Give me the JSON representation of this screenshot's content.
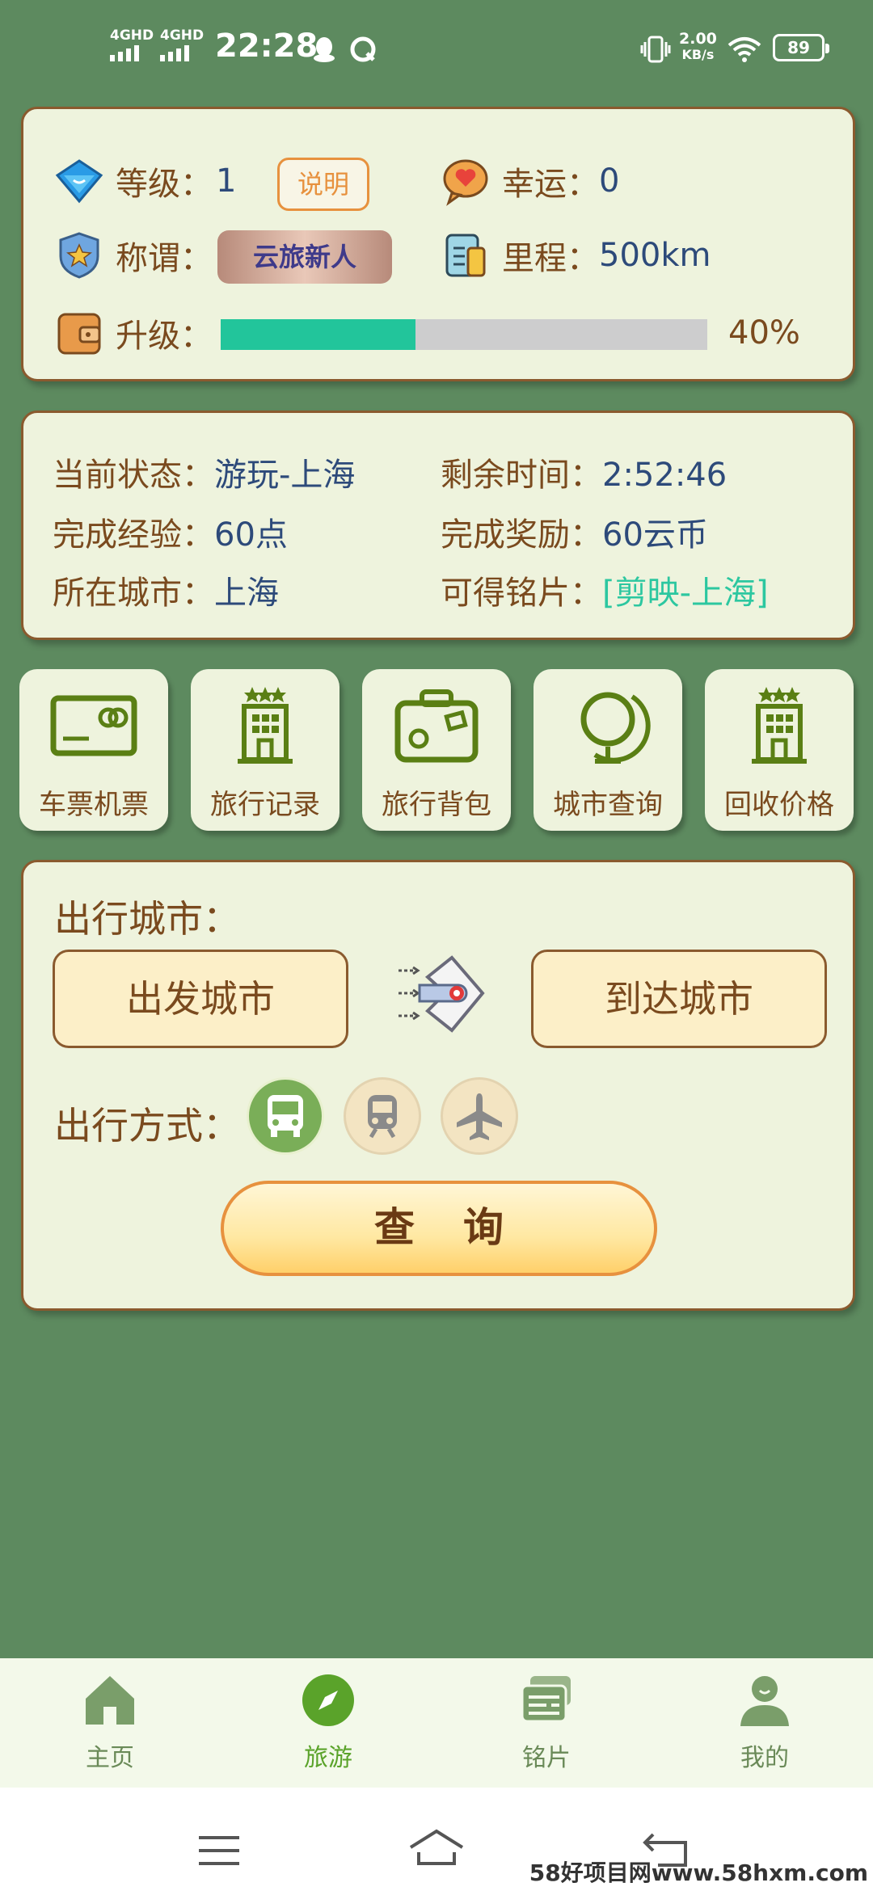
{
  "status_bar": {
    "signal1": "4GHD",
    "signal2": "4GHD",
    "time": "22:28",
    "speed_value": "2.00",
    "speed_unit": "KB/s",
    "battery": "89"
  },
  "profile": {
    "level_label": "等级：",
    "level_value": "1",
    "explain_button": "说明",
    "luck_label": "幸运：",
    "luck_value": "0",
    "title_label": "称谓：",
    "title_badge": "云旅新人",
    "mileage_label": "里程：",
    "mileage_value": "500km",
    "upgrade_label": "升级：",
    "upgrade_progress_percent": 40,
    "upgrade_percent_text": "40%"
  },
  "status_info": {
    "current_status_label": "当前状态：",
    "current_status_value": "游玩-上海",
    "remaining_time_label": "剩余时间：",
    "remaining_time_value": "2:52:46",
    "exp_label": "完成经验：",
    "exp_value": "60点",
    "reward_label": "完成奖励：",
    "reward_value": "60云币",
    "city_label": "所在城市：",
    "city_value": "上海",
    "postcard_label": "可得铭片：",
    "postcard_value": "[剪映-上海]"
  },
  "menu": [
    {
      "label": "车票机票",
      "icon": "ticket-icon"
    },
    {
      "label": "旅行记录",
      "icon": "hotel-icon"
    },
    {
      "label": "旅行背包",
      "icon": "suitcase-icon"
    },
    {
      "label": "城市查询",
      "icon": "globe-icon"
    },
    {
      "label": "回收价格",
      "icon": "hotel-icon"
    }
  ],
  "travel": {
    "city_heading": "出行城市：",
    "departure_button": "出发城市",
    "arrival_button": "到达城市",
    "mode_heading": "出行方式：",
    "modes": [
      "bus-icon",
      "train-icon",
      "airplane-icon"
    ],
    "query_button": "查询"
  },
  "bottom_nav": [
    {
      "label": "主页",
      "icon": "home-icon"
    },
    {
      "label": "旅游",
      "icon": "compass-icon"
    },
    {
      "label": "铭片",
      "icon": "cards-icon"
    },
    {
      "label": "我的",
      "icon": "user-icon"
    }
  ],
  "colors": {
    "background": "#5d8a5f",
    "card": "#eef3dd",
    "accent_green": "#22c59b",
    "nav_active": "#5aa32a",
    "nav_inactive": "#7a9e6a"
  },
  "watermark": "58好项目网www.58hxm.com"
}
